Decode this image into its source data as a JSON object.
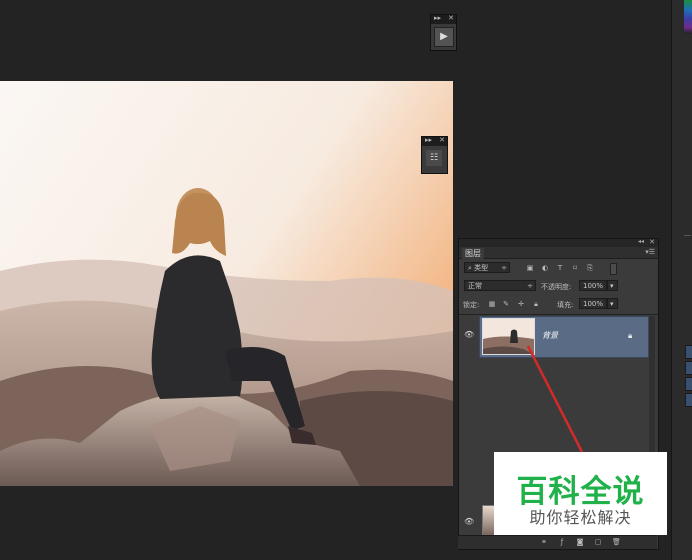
{
  "layers_panel": {
    "tab_label": "图层",
    "filter_kind": "类型",
    "blend_mode": "正常",
    "opacity_label": "不透明度:",
    "opacity_value": "100%",
    "lock_label": "锁定:",
    "fill_label": "填充:",
    "fill_value": "100%",
    "layer_name": "背景"
  },
  "watermark": {
    "title": "百科全说",
    "subtitle": "助你轻松解决"
  },
  "colors": {
    "app_background": "#232323",
    "panel_background": "#3b3b3b",
    "selected_layer": "#5a6b85",
    "annotation_arrow": "#d42a2a",
    "watermark_green": "#20b14a"
  },
  "icons": {
    "play": "play-icon",
    "visibility": "eye-icon",
    "lock": "lock-icon",
    "panel_menu": "panel-menu-icon",
    "close": "close-icon",
    "collapse": "collapse-icon"
  }
}
